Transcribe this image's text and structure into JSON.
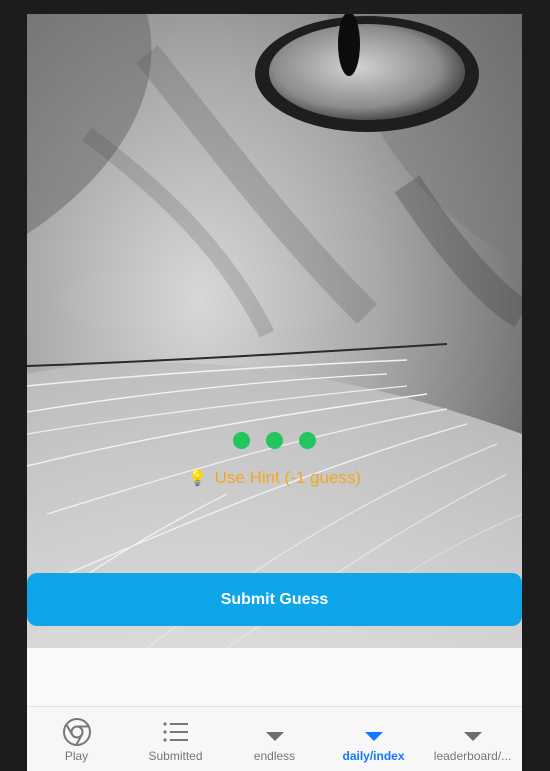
{
  "colors": {
    "dot": "#22c55e",
    "hint": "#f5a623",
    "submit_bg": "#0ea5e9",
    "tab_active": "#1677ff",
    "tab_inactive": "#777777"
  },
  "progress": {
    "remaining_guesses": 3
  },
  "hint": {
    "icon": "lightbulb-icon",
    "label": "Use Hint (-1 guess)"
  },
  "actions": {
    "submit_label": "Submit Guess"
  },
  "tabs": [
    {
      "label": "Play",
      "icon": "chrome-icon",
      "active": false
    },
    {
      "label": "Submitted",
      "icon": "list-icon",
      "active": false
    },
    {
      "label": "endless",
      "icon": "triangle-down-icon",
      "active": false
    },
    {
      "label": "daily/index",
      "icon": "triangle-down-icon",
      "active": true
    },
    {
      "label": "leaderboard/...",
      "icon": "triangle-down-icon",
      "active": false
    }
  ]
}
